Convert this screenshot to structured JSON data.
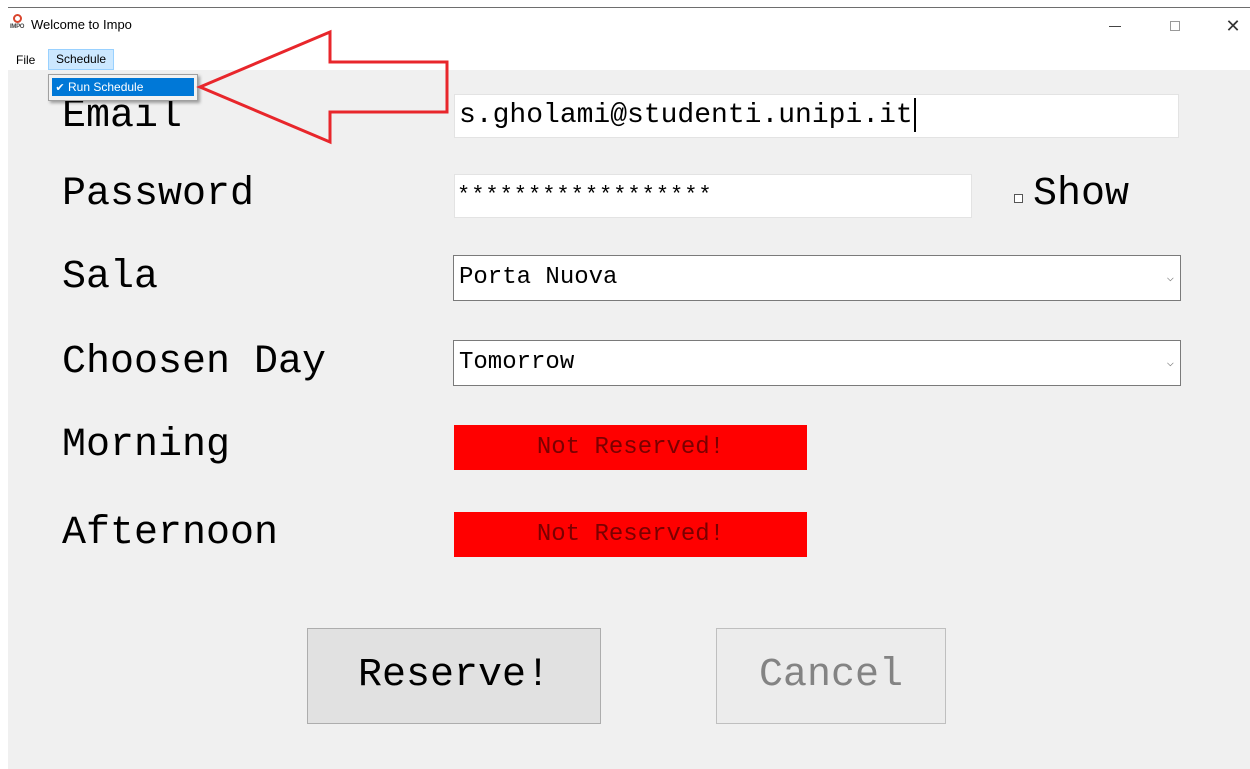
{
  "window": {
    "title": "Welcome to Impo",
    "icon": "impo-app-icon",
    "icon_text": "IMPO",
    "controls": [
      "minimize-icon",
      "maximize-icon",
      "close-icon"
    ]
  },
  "menubar": {
    "file_label": "File",
    "schedule_label": "Schedule"
  },
  "schedule_menu": {
    "items": [
      {
        "label": "Run Schedule",
        "checked": true,
        "icon": "checkmark-icon"
      }
    ]
  },
  "form": {
    "email_label": "Email",
    "email_value": "s.gholami@studenti.unipi.it",
    "password_label": "Password",
    "password_value": "******************",
    "show_label": "Show",
    "show_checked": false,
    "sala_label": "Sala",
    "sala_value": "Porta Nuova",
    "day_label": "Choosen Day",
    "day_value": "Tomorrow",
    "morning_label": "Morning",
    "morning_status": "Not Reserved!",
    "afternoon_label": "Afternoon",
    "afternoon_status": "Not Reserved!"
  },
  "buttons": {
    "reserve_label": "Reserve!",
    "cancel_label": "Cancel"
  },
  "annotation": {
    "arrow_color": "#e8262b",
    "icon": "red-arrow-annotation"
  },
  "colors": {
    "status_bg": "#ff0000",
    "status_text": "#7a0000",
    "menu_highlight": "#0078d7",
    "client_bg": "#f0f0f0"
  }
}
